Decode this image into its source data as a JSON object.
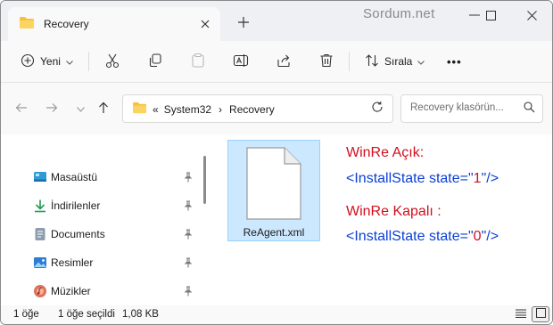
{
  "window": {
    "tab_title": "Recovery",
    "watermark": "Sordum.net",
    "new_tab": "+"
  },
  "toolbar": {
    "new_label": "Yeni",
    "sort_label": "Sırala",
    "more": "•••",
    "icons": [
      "plus-circle-icon",
      "cut-icon",
      "copy-icon",
      "paste-icon",
      "rename-icon",
      "share-icon",
      "delete-icon",
      "sort-icon",
      "more-icon"
    ]
  },
  "address": {
    "overflow": "«",
    "crumbs": [
      "System32",
      "Recovery"
    ],
    "separator": "›",
    "search_placeholder": "Recovery klasörün..."
  },
  "sidebar": {
    "items": [
      {
        "label": "Masaüstü",
        "icon": "desktop-icon",
        "pinned": true
      },
      {
        "label": "İndirilenler",
        "icon": "download-icon",
        "pinned": true
      },
      {
        "label": "Documents",
        "icon": "documents-icon",
        "pinned": true
      },
      {
        "label": "Resimler",
        "icon": "pictures-icon",
        "pinned": true
      },
      {
        "label": "Müzikler",
        "icon": "music-icon",
        "pinned": true
      }
    ]
  },
  "content": {
    "file_name": "ReAgent.xml",
    "note_on_title": "WinRe Açık:",
    "note_on_code_before": "<InstallState state=\"",
    "note_on_value": "1",
    "note_on_code_after": "\"/>",
    "note_off_title": "WinRe Kapalı :",
    "note_off_code_before": "<InstallState state=\"",
    "note_off_value": "0",
    "note_off_code_after": "\"/>"
  },
  "status": {
    "item_count": "1 öğe",
    "selected": "1 öğe seçildi",
    "size": "1,08 KB"
  },
  "colors": {
    "accent_red": "#d20f1e",
    "accent_blue": "#0b40d6",
    "selection": "#cce8ff",
    "folder": "#f8c33c"
  }
}
